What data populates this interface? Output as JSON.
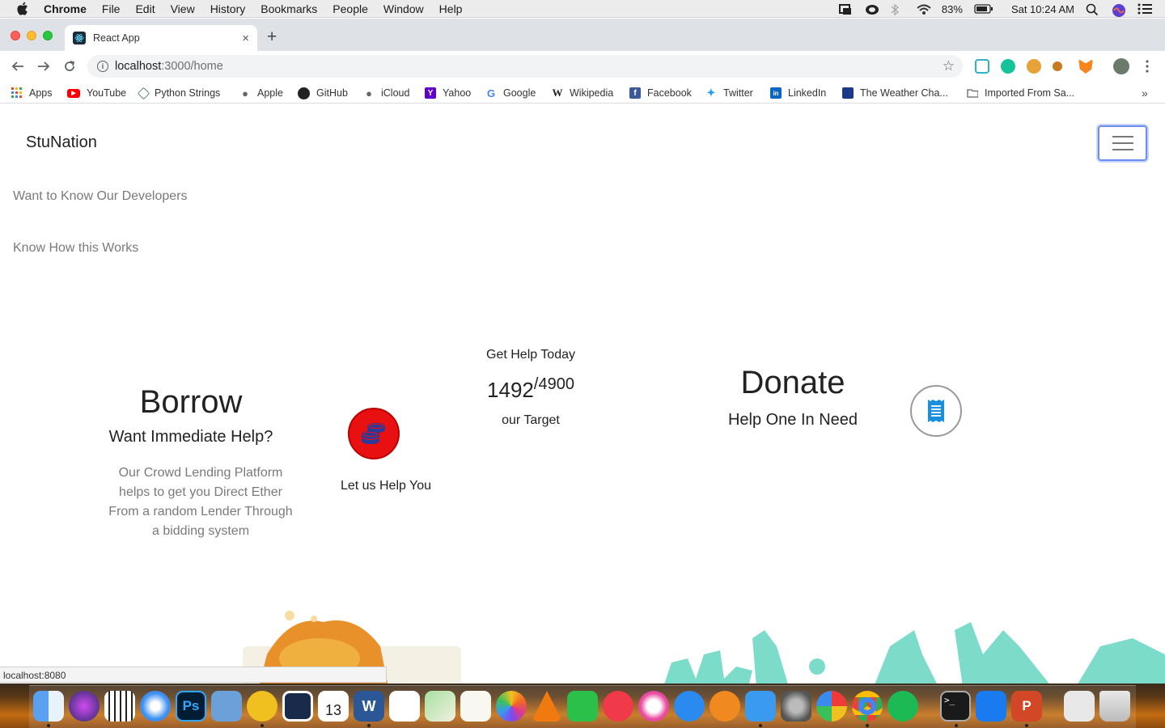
{
  "menubar": {
    "app_name": "Chrome",
    "items": [
      "File",
      "Edit",
      "View",
      "History",
      "Bookmarks",
      "People",
      "Window",
      "Help"
    ],
    "battery": "83%",
    "clock": "Sat 10:24 AM"
  },
  "browser": {
    "tab_title": "React App",
    "tab_close": "×",
    "new_tab": "+",
    "url_host": "localhost",
    "url_path": ":3000/home",
    "bookmarks": [
      "Apps",
      "YouTube",
      "Python Strings",
      "Apple",
      "GitHub",
      "iCloud",
      "Yahoo",
      "Google",
      "Wikipedia",
      "Facebook",
      "Twitter",
      "LinkedIn",
      "The Weather Cha...",
      "Imported From Sa..."
    ],
    "overflow": "»"
  },
  "page": {
    "brand": "StuNation",
    "nav_links": [
      "Want to Know Our Developers",
      "Know How this Works"
    ],
    "borrow": {
      "title": "Borrow",
      "subtitle": "Want Immediate Help?",
      "description": "Our Crowd Lending Platform helps to get you Direct Ether From a random Lender Through a bidding system",
      "button_caption": "Let us Help You",
      "button_color": "#e81010"
    },
    "get_help": {
      "title": "Get Help Today",
      "current": "1492",
      "target_value": "/4900",
      "target_label": "our Target"
    },
    "donate": {
      "title": "Donate",
      "subtitle": "Help One In Need",
      "icon_color": "#1a8fe0"
    }
  },
  "statusbar": {
    "url": "localhost:8080"
  }
}
